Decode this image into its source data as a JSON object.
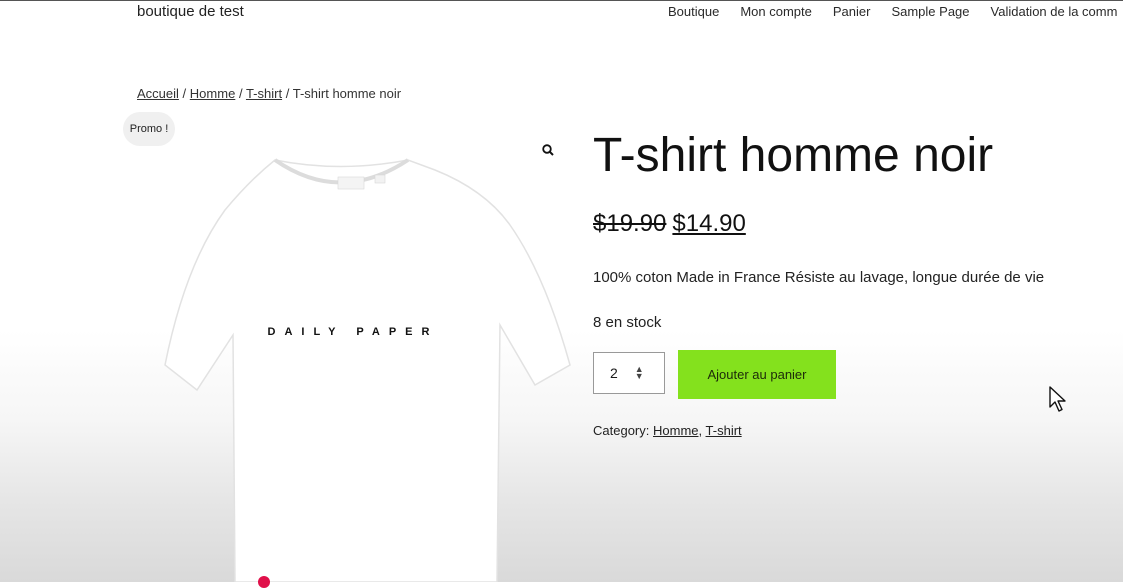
{
  "header": {
    "site_title": "boutique de test",
    "nav": [
      "Boutique",
      "Mon compte",
      "Panier",
      "Sample Page",
      "Validation de la comm"
    ]
  },
  "breadcrumb": {
    "items": [
      "Accueil",
      "Homme",
      "T-shirt"
    ],
    "separator": "/",
    "current": "T-shirt homme noir"
  },
  "product": {
    "badge": "Promo !",
    "image_print": "DAILY PAPER",
    "title": "T-shirt homme noir",
    "old_price": "$19.90",
    "new_price": "$14.90",
    "description": "100% coton Made in France Résiste au lavage, longue durée de vie",
    "stock": "8 en stock",
    "quantity": "2",
    "add_to_cart": "Ajouter au panier",
    "category_label": "Category:",
    "categories": [
      "Homme",
      "T-shirt"
    ],
    "category_separator": ","
  },
  "colors": {
    "button": "#84e11d",
    "accent_dot": "#e0104a"
  },
  "icons": {
    "zoom": "magnifier-icon",
    "cursor": "mouse-pointer-icon"
  }
}
